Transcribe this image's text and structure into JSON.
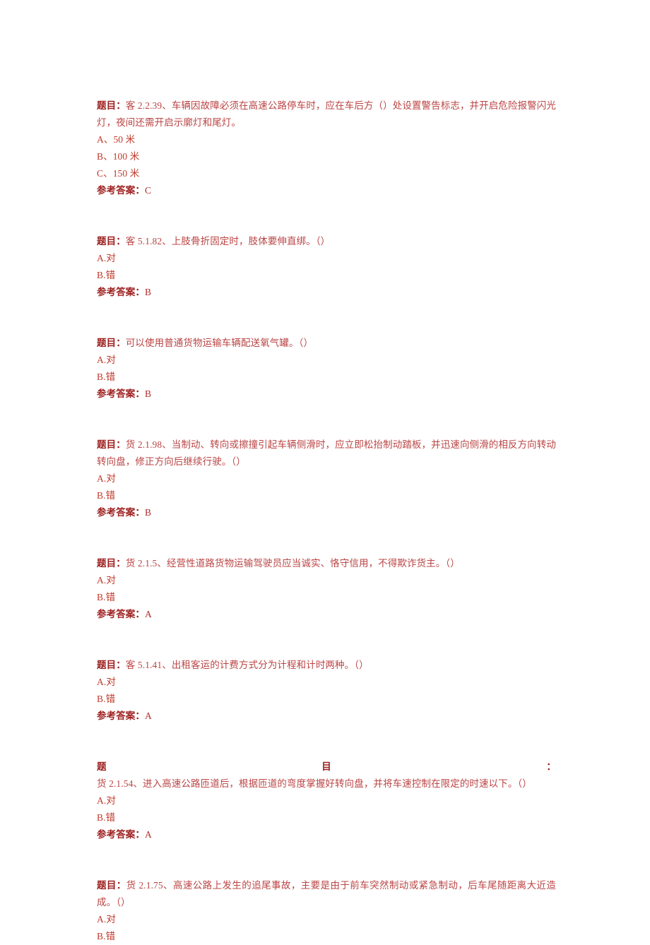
{
  "document": {
    "text_color": "#b02a2a",
    "label_color": "#9e1f1f",
    "background": "#ffffff",
    "question_label": "题目：",
    "answer_label": "参考答案："
  },
  "questions": [
    {
      "label": "题目：",
      "text": "客 2.2.39、车辆因故障必须在高速公路停车时，应在车后方（）处设置警告标志，并开启危险报警闪光灯，夜间还需开启示廓灯和尾灯。",
      "options": [
        "A、50 米",
        "B、100 米",
        "C、150 米"
      ],
      "answer_label": "参考答案：",
      "answer": "C"
    },
    {
      "label": "题目：",
      "text": "客 5.1.82、上肢骨折固定时，肢体要伸直绑。（）",
      "options": [
        "A.对",
        "B.错"
      ],
      "answer_label": "参考答案：",
      "answer": "B"
    },
    {
      "label": "题目：",
      "text": "可以使用普通货物运输车辆配送氧气罐。（）",
      "options": [
        "A.对",
        "B.错"
      ],
      "answer_label": "参考答案：",
      "answer": "B"
    },
    {
      "label": "题目：",
      "text": "货 2.1.98、当制动、转向或擦撞引起车辆侧滑时，应立即松抬制动踏板，并迅速向侧滑的相反方向转动转向盘，修正方向后继续行驶。（）",
      "options": [
        "A.对",
        "B.错"
      ],
      "answer_label": "参考答案：",
      "answer": "B"
    },
    {
      "label": "题目：",
      "text": "货 2.1.5、经营性道路货物运输驾驶员应当诚实、恪守信用，不得欺诈货主。（）",
      "options": [
        "A.对",
        "B.错"
      ],
      "answer_label": "参考答案：",
      "answer": "A"
    },
    {
      "label": "题目：",
      "text": "客 5.1.41、出租客运的计费方式分为计程和计时两种。（）",
      "options": [
        "A.对",
        "B.错"
      ],
      "answer_label": "参考答案：",
      "answer": "A"
    },
    {
      "label": "题目：",
      "text": "货 2.1.54、进入高速公路匝道后，根据匝道的弯度掌握好转向盘，并将车速控制在限定的时速以下。（）",
      "options": [
        "A.对",
        "B.错"
      ],
      "answer_label": "参考答案：",
      "answer": "A"
    },
    {
      "label": "题目：",
      "text": "货 2.1.75、高速公路上发生的追尾事故，主要是由于前车突然制动或紧急制动，后车尾随距离大近造成。（）",
      "options": [
        "A.对",
        "B.错"
      ],
      "answer_label": null,
      "answer": null
    }
  ]
}
